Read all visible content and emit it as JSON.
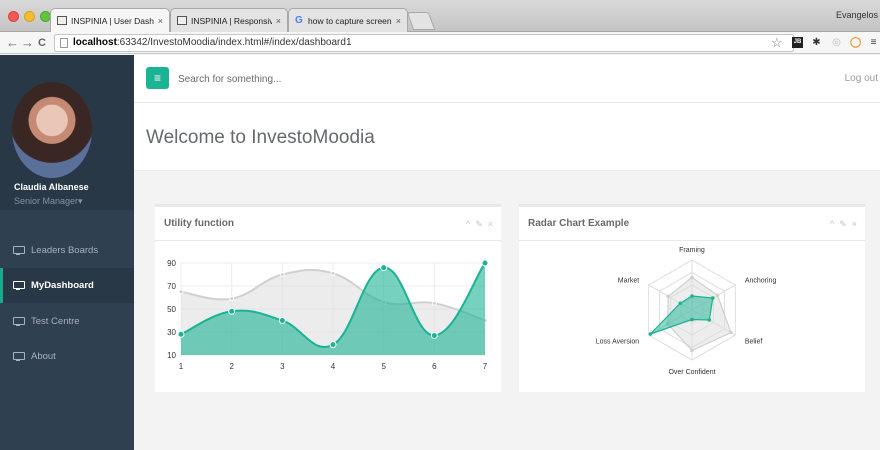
{
  "browser": {
    "tabs": [
      {
        "title": "INSPINIA | User Dashboard",
        "close": "×"
      },
      {
        "title": "INSPINIA | Responsive Adm",
        "close": "×"
      },
      {
        "title": "how to capture screen on a",
        "close": "×"
      }
    ],
    "google_glyph": "G",
    "profile_name": "Evangelos",
    "url_host": "localhost",
    "url_rest": ":63342/InvestoMoodia/index.html#/index/dashboard1",
    "nav": {
      "back": "←",
      "forward": "→",
      "reload": "C"
    },
    "star": "☆",
    "extensions": [
      "JB",
      "✱",
      "◎",
      "◯",
      "≡"
    ]
  },
  "topbar": {
    "menu_glyph": "≡",
    "search_placeholder": "Search for something...",
    "logout": "Log out"
  },
  "sidebar": {
    "name": "Claudia Albanese",
    "role": "Senior Manager",
    "role_caret": "▾",
    "items": [
      {
        "label": "Leaders Boards",
        "active": false
      },
      {
        "label": "MyDashboard",
        "active": true
      },
      {
        "label": "Test Centre",
        "active": false
      },
      {
        "label": "About",
        "active": false
      }
    ]
  },
  "page": {
    "title": "Welcome to InvestoMoodia"
  },
  "cards": {
    "utility": {
      "title": "Utility function"
    },
    "radar": {
      "title": "Radar Chart Example"
    },
    "tools": {
      "collapse": "^",
      "config": "✎",
      "close": "×"
    }
  },
  "colors": {
    "accent": "#1ab394",
    "sidebar": "#2f4050",
    "grey_series": "#dcdcdc"
  },
  "chart_data": [
    {
      "type": "area",
      "title": "Utility function",
      "x": [
        1,
        2,
        3,
        4,
        5,
        6,
        7
      ],
      "yticks": [
        10,
        30,
        50,
        70,
        90
      ],
      "ylim": [
        10,
        90
      ],
      "grid": true,
      "series": [
        {
          "values": [
            65,
            59,
            80,
            81,
            56,
            55,
            40
          ],
          "color": "#dcdcdc"
        },
        {
          "values": [
            28,
            48,
            40,
            19,
            86,
            27,
            90
          ],
          "color": "#1ab394"
        }
      ]
    },
    {
      "type": "radar",
      "title": "Radar Chart Example",
      "categories": [
        "Framing",
        "Anchoring",
        "Belief",
        "Over Confident",
        "Loss Aversion",
        "Market"
      ],
      "rmax": 100,
      "rings": 4,
      "series": [
        {
          "values": [
            65,
            59,
            90,
            81,
            56,
            55
          ],
          "color": "#dcdcdc"
        },
        {
          "values": [
            28,
            48,
            40,
            19,
            96,
            27
          ],
          "color": "#1ab394"
        }
      ]
    }
  ]
}
